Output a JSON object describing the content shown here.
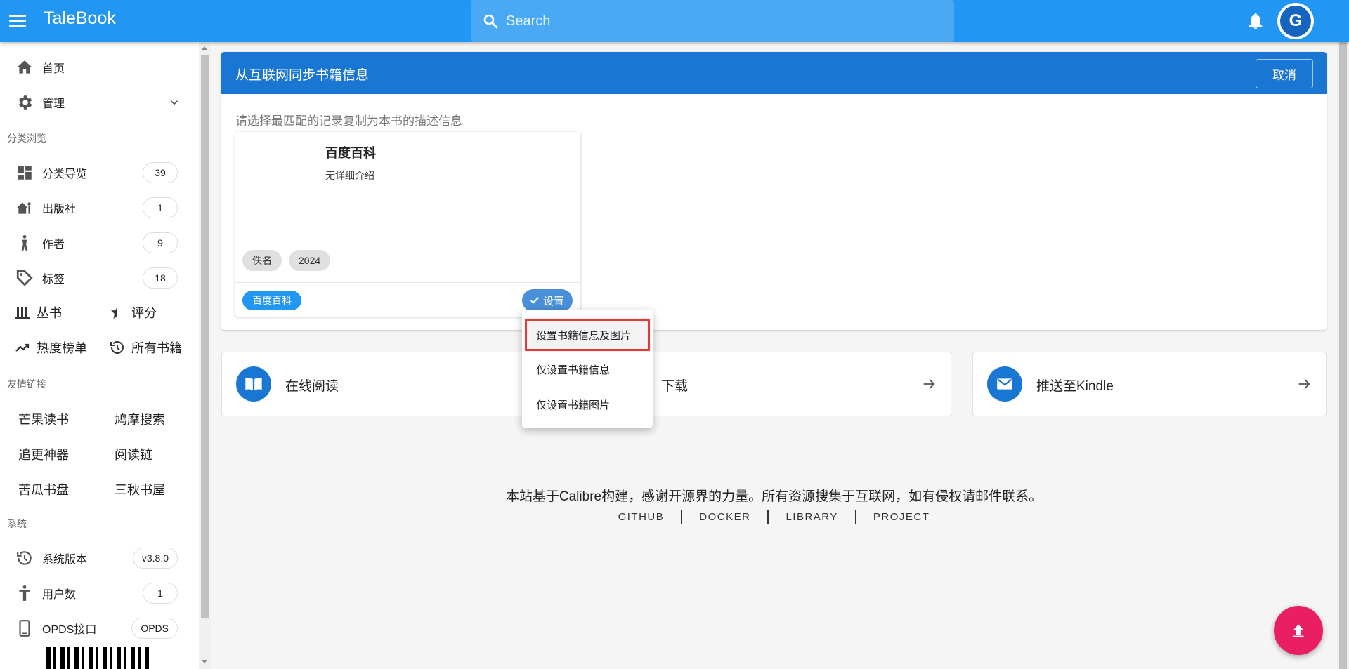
{
  "app": {
    "title": "TaleBook"
  },
  "search": {
    "placeholder": "Search"
  },
  "sidebar": {
    "home": "首页",
    "manage": "管理",
    "section_browse": "分类浏览",
    "browse_items": [
      {
        "label": "分类导览",
        "count": "39"
      },
      {
        "label": "出版社",
        "count": "1"
      },
      {
        "label": "作者",
        "count": "9"
      },
      {
        "label": "标签",
        "count": "18"
      }
    ],
    "series": "丛书",
    "rating": "评分",
    "hot": "热度榜单",
    "all_books": "所有书籍",
    "section_links": "友情链接",
    "links": [
      "芒果读书",
      "鸠摩搜索",
      "追更神器",
      "阅读链",
      "苦瓜书盘",
      "三秋书屋"
    ],
    "section_system": "系统",
    "system_items": [
      {
        "label": "系统版本",
        "count": "v3.8.0"
      },
      {
        "label": "用户数",
        "count": "1"
      },
      {
        "label": "OPDS接口",
        "count": "OPDS"
      }
    ]
  },
  "sync": {
    "title": "从互联网同步书籍信息",
    "cancel": "取消",
    "hint": "请选择最匹配的记录复制为本书的描述信息",
    "result": {
      "title": "百度百科",
      "desc": "无详细介绍",
      "chips": [
        "佚名",
        "2024"
      ],
      "source": "百度百科",
      "set_label": "设置"
    }
  },
  "dropdown": {
    "items": [
      "设置书籍信息及图片",
      "仅设置书籍信息",
      "仅设置书籍图片"
    ]
  },
  "actions": [
    {
      "label": "在线阅读"
    },
    {
      "label": "下载"
    },
    {
      "label": "推送至Kindle"
    }
  ],
  "footer": {
    "text": "本站基于Calibre构建，感谢开源界的力量。所有资源搜集于互联网，如有侵权请邮件联系。",
    "links": [
      "GITHUB",
      "DOCKER",
      "LIBRARY",
      "PROJECT"
    ]
  },
  "colors": {
    "appbar": "#2196f3",
    "header": "#1976d2",
    "fab": "#e91e63",
    "highlight": "#e53935"
  }
}
